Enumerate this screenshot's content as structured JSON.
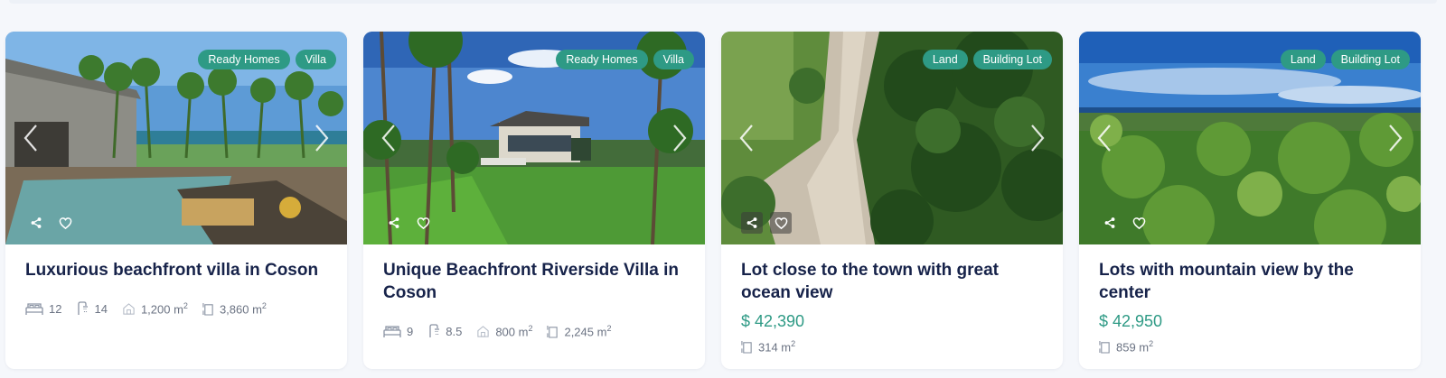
{
  "colors": {
    "accent": "#2e9a85",
    "title": "#17234a",
    "meta": "#6b7383"
  },
  "cards": [
    {
      "tags": [
        "Ready Homes",
        "Villa"
      ],
      "title": "Luxurious beachfront villa in Coson",
      "beds": "12",
      "baths": "14",
      "built": "1,200 m",
      "lot": "3,860 m",
      "unit_exp": "2"
    },
    {
      "tags": [
        "Ready Homes",
        "Villa"
      ],
      "title": "Unique Beachfront Riverside Villa in Coson",
      "beds": "9",
      "baths": "8.5",
      "built": "800 m",
      "lot": "2,245 m",
      "unit_exp": "2"
    },
    {
      "tags": [
        "Land",
        "Building Lot"
      ],
      "title": "Lot close to the town with great ocean view",
      "price": "$ 42,390",
      "lot": "314 m",
      "unit_exp": "2"
    },
    {
      "tags": [
        "Land",
        "Building Lot"
      ],
      "title": "Lots with mountain view by the center",
      "price": "$ 42,950",
      "lot": "859 m",
      "unit_exp": "2"
    }
  ],
  "icons": {
    "share": "share-icon",
    "favorite": "heart-icon",
    "prev": "chevron-left-icon",
    "next": "chevron-right-icon",
    "beds": "bed-icon",
    "baths": "shower-icon",
    "built": "house-area-icon",
    "lot": "lot-area-icon"
  }
}
